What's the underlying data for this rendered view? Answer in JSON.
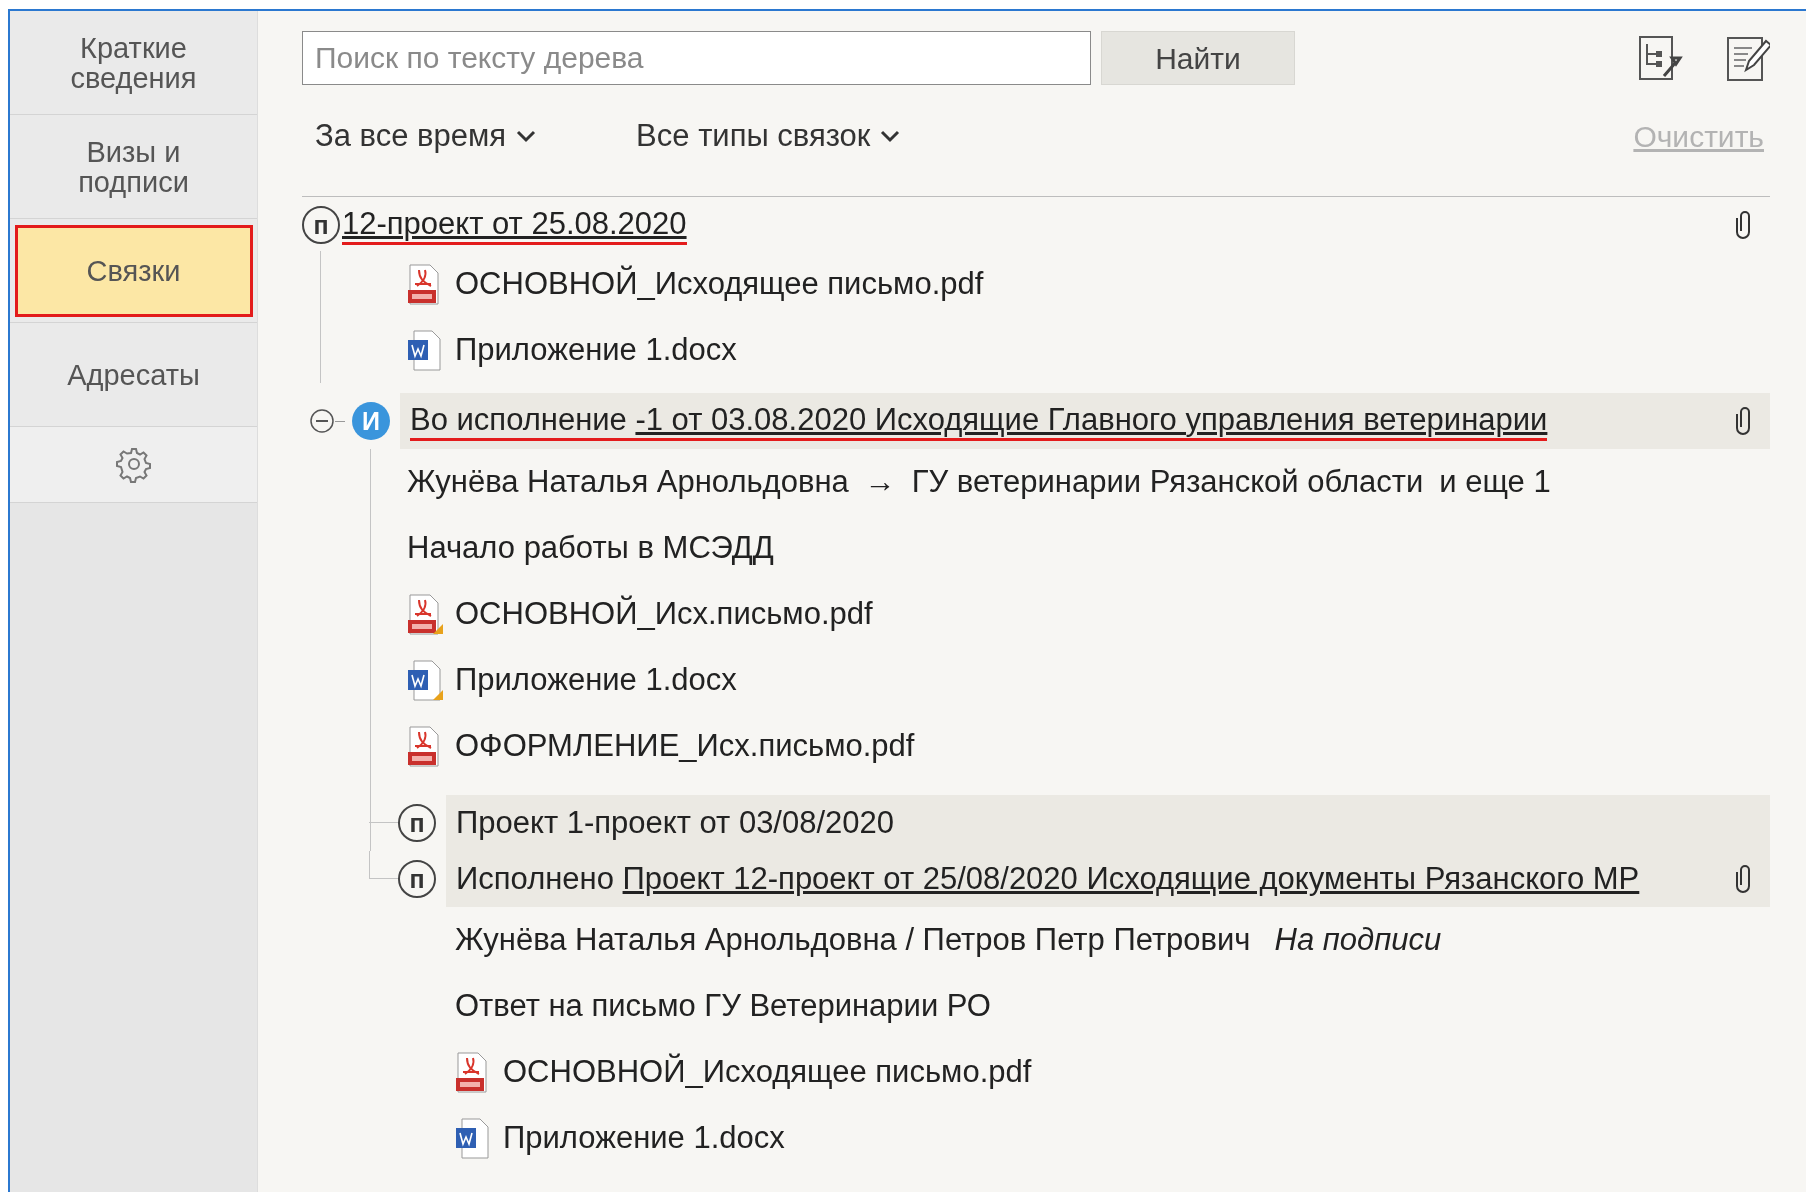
{
  "sidebar": {
    "items": [
      {
        "kind": "tab",
        "label": "Краткие сведения",
        "selected": false,
        "annotated": false
      },
      {
        "kind": "tab",
        "label": "Визы и подписи",
        "selected": false,
        "annotated": false
      },
      {
        "kind": "tab",
        "label": "Связки",
        "selected": true,
        "annotated": true
      },
      {
        "kind": "tab",
        "label": "Адресаты",
        "selected": false,
        "annotated": false
      },
      {
        "kind": "settings",
        "selected": false,
        "annotated": false
      }
    ]
  },
  "search": {
    "placeholder": "Поиск по тексту дерева",
    "button": "Найти"
  },
  "filters": [
    {
      "label": "За все время"
    },
    {
      "label": "Все типы связок"
    }
  ],
  "clear_link": {
    "label": "Очистить",
    "disabled": true
  },
  "tree": [
    {
      "kind": "project",
      "badge": "п",
      "link": "12-проект от 25.08.2020",
      "attachment": true,
      "highlighted": false,
      "annotated": true,
      "items": [
        {
          "kind": "pdf",
          "name": "ОСНОВНОЙ_Исходящее письмо.pdf",
          "signed": false
        },
        {
          "kind": "docx",
          "name": "Приложение 1.docx",
          "signed": false
        }
      ]
    },
    {
      "kind": "execution",
      "badge": "И",
      "expanded": true,
      "title": "Во исполнение",
      "link": "-1 от 03.08.2020 Исходящие Главного управления ветеринарии",
      "attachment": true,
      "highlighted": true,
      "annotated": true,
      "items": [
        {
          "kind": "route",
          "from": "Жунёва Наталья Арнольдовна",
          "arrow": "→",
          "to": "ГУ ветеринарии Рязанской области",
          "extra": "и еще 1"
        },
        {
          "kind": "note",
          "text": "Начало работы в МСЭДД"
        },
        {
          "kind": "pdf",
          "name": "ОСНОВНОЙ_Исх.письмо.pdf",
          "signed": true
        },
        {
          "kind": "docx",
          "name": "Приложение 1.docx",
          "signed": true
        },
        {
          "kind": "pdf",
          "name": "ОФОРМЛЕНИЕ_Исх.письмо.pdf",
          "signed": false
        },
        {
          "kind": "node",
          "node": {
            "kind": "project",
            "badge": "п",
            "title": "Проект 1-проект от 03/08/2020",
            "attachment": false,
            "highlighted": true,
            "annotated": false
          }
        },
        {
          "kind": "node",
          "node": {
            "kind": "project",
            "badge": "п",
            "title": "Исполнено",
            "link": "Проект 12-проект от 25/08/2020 Исходящие документы Рязанского МР",
            "attachment": true,
            "highlighted": true,
            "annotated": false,
            "items": [
              {
                "kind": "signers",
                "people": "Жунёва Наталья Арнольдовна / Петров Петр Петрович",
                "status": "На подписи"
              },
              {
                "kind": "note",
                "text": "Ответ на письмо ГУ Ветеринарии РО"
              },
              {
                "kind": "pdf",
                "name": "ОСНОВНОЙ_Исходящее письмо.pdf",
                "signed": false
              },
              {
                "kind": "docx",
                "name": "Приложение 1.docx",
                "signed": false
              }
            ]
          }
        }
      ]
    }
  ]
}
